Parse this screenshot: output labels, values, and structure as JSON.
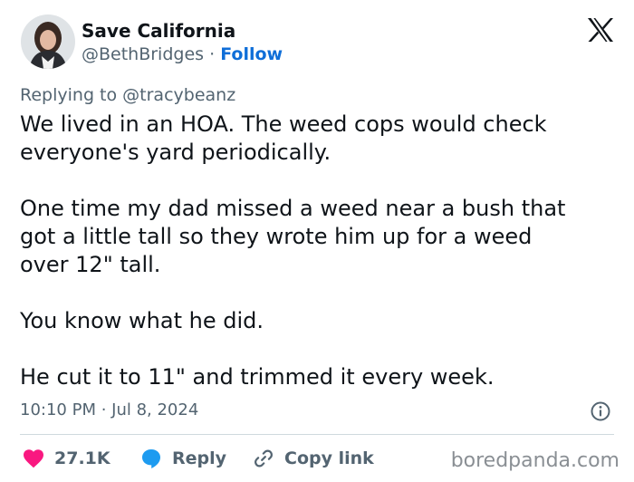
{
  "author": {
    "display_name": "Save California",
    "handle": "@BethBridges",
    "separator": "·",
    "follow_label": "Follow"
  },
  "reply_context": {
    "prefix": "Replying to",
    "mention": "@tracybeanz"
  },
  "tweet": {
    "paragraphs": [
      "We lived in an HOA. The weed cops would check everyone's yard periodically.",
      "One time my dad missed a weed near a bush that got a little tall so they wrote him up for a weed over 12\" tall.",
      "You know what he did.",
      "He cut it to 11\" and trimmed it every week."
    ],
    "line_breaks": [
      [
        "We lived in an HOA. The weed cops would check",
        "everyone's yard periodically."
      ],
      [
        "One time my dad missed a weed near a bush that",
        "got a little tall so they wrote him up for a weed",
        "over 12\" tall."
      ],
      [
        "You know what he did."
      ],
      [
        "He cut it to 11\" and trimmed it every week."
      ]
    ],
    "timestamp": "10:10 PM · Jul 8, 2024"
  },
  "actions": {
    "like_count": "27.1K",
    "reply_label": "Reply",
    "copy_link_label": "Copy link"
  },
  "icons": {
    "platform_logo": "x-logo-icon",
    "info": "info-icon",
    "like": "heart-icon",
    "reply": "speech-bubble-icon",
    "copy_link": "link-icon"
  },
  "colors": {
    "text": "#0f1419",
    "secondary_text": "#536471",
    "follow": "#0f6ed8",
    "like": "#f91880",
    "reply": "#1d9bf0",
    "divider": "#cfd9de"
  },
  "watermark": "boredpanda.com"
}
